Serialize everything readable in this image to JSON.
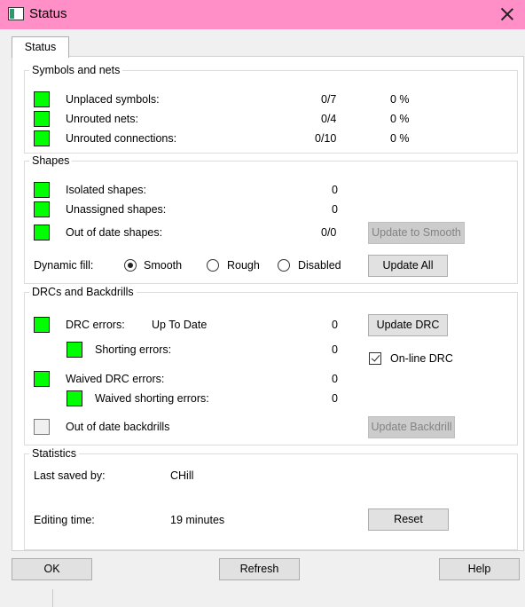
{
  "window": {
    "title": "Status",
    "app_icon": "window-app-icon",
    "close_icon": "close-icon"
  },
  "tab": {
    "label": "Status"
  },
  "symbols_nets": {
    "title": "Symbols and nets",
    "rows": [
      {
        "label": "Unplaced symbols:",
        "count": "0/7",
        "percent": "0 %"
      },
      {
        "label": "Unrouted nets:",
        "count": "0/4",
        "percent": "0 %"
      },
      {
        "label": "Unrouted connections:",
        "count": "0/10",
        "percent": "0 %"
      }
    ]
  },
  "shapes": {
    "title": "Shapes",
    "rows": [
      {
        "label": "Isolated shapes:",
        "count": "0"
      },
      {
        "label": "Unassigned shapes:",
        "count": "0"
      },
      {
        "label": "Out of date shapes:",
        "count": "0/0"
      }
    ],
    "update_smooth_label": "Update to Smooth",
    "dynamic_fill_label": "Dynamic fill:",
    "fill_options": [
      "Smooth",
      "Rough",
      "Disabled"
    ],
    "fill_selected": "Smooth",
    "update_all_label": "Update All"
  },
  "drc": {
    "title": "DRCs and Backdrills",
    "drc_errors_label": "DRC errors:",
    "drc_status": "Up To Date",
    "drc_errors_count": "0",
    "update_drc_label": "Update DRC",
    "shorting_label": "Shorting errors:",
    "shorting_count": "0",
    "online_drc_label": "On-line DRC",
    "online_drc_checked": true,
    "waived_drc_label": "Waived DRC errors:",
    "waived_drc_count": "0",
    "waived_shorting_label": "Waived shorting errors:",
    "waived_shorting_count": "0",
    "backdrills_label": "Out of date backdrills",
    "update_backdrill_label": "Update Backdrill"
  },
  "statistics": {
    "title": "Statistics",
    "last_saved_label": "Last saved by:",
    "last_saved_value": "CHill",
    "editing_time_label": "Editing time:",
    "editing_time_value": "19 minutes",
    "reset_label": "Reset"
  },
  "footer": {
    "ok_label": "OK",
    "refresh_label": "Refresh",
    "help_label": "Help"
  },
  "colors": {
    "titlebar": "#ff8fc6",
    "status_ok": "#00ff00"
  }
}
